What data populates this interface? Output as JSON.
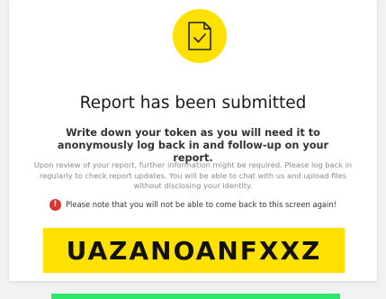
{
  "colors": {
    "accent_yellow": "#ffe100",
    "warning_red": "#d9342b",
    "next_green": "#2ee66e"
  },
  "icon": {
    "name": "document-check-icon"
  },
  "title": "Report has been submitted",
  "instruction": "Write down your token as you will need it to anonymously log back in and follow-up on your report.",
  "details": "Upon review of your report, further information might be required. Please log back in regularly to check report updates. You will be able to chat with us and upload files without disclosing your identity.",
  "warning": {
    "icon": "exclamation-icon",
    "glyph": "!",
    "text": "Please note that you will not be able to come back to this screen again!"
  },
  "token": "UAZANOANFXXZ"
}
